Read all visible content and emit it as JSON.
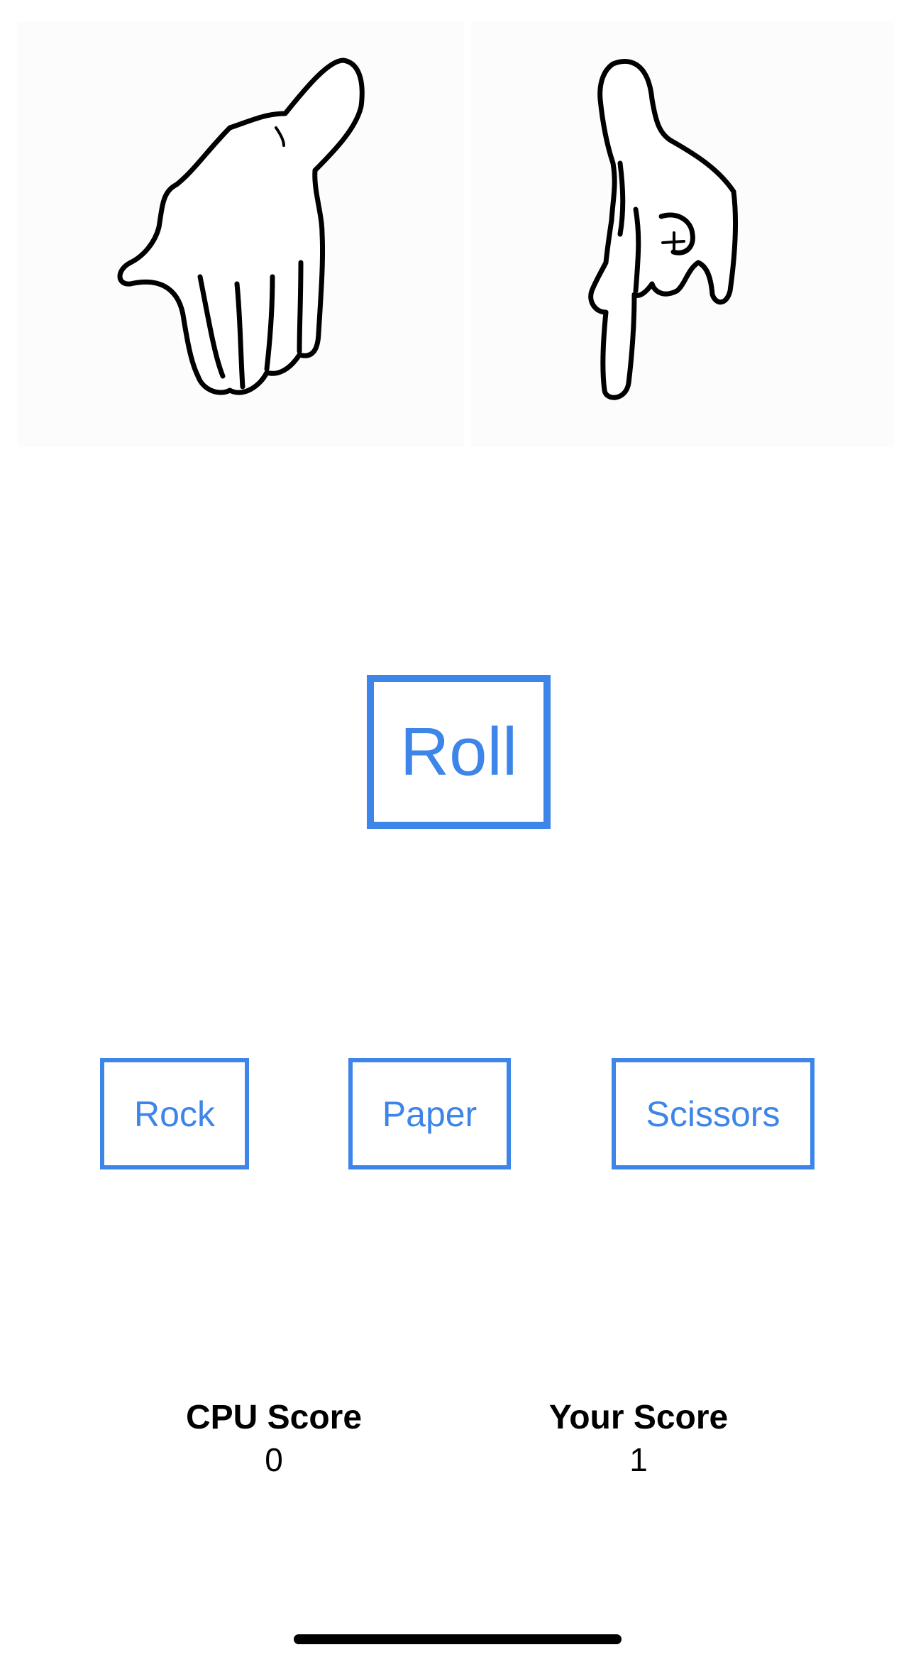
{
  "hands": {
    "cpu": {
      "icon": "hand-paper-icon"
    },
    "player": {
      "icon": "hand-scissors-icon"
    }
  },
  "roll_button": {
    "label": "Roll"
  },
  "choices": {
    "rock": "Rock",
    "paper": "Paper",
    "scissors": "Scissors"
  },
  "scores": {
    "cpu_label": "CPU Score",
    "cpu_value": "0",
    "player_label": "Your Score",
    "player_value": "1"
  },
  "colors": {
    "accent": "#3d85e8",
    "text": "#000000",
    "background": "#ffffff"
  }
}
